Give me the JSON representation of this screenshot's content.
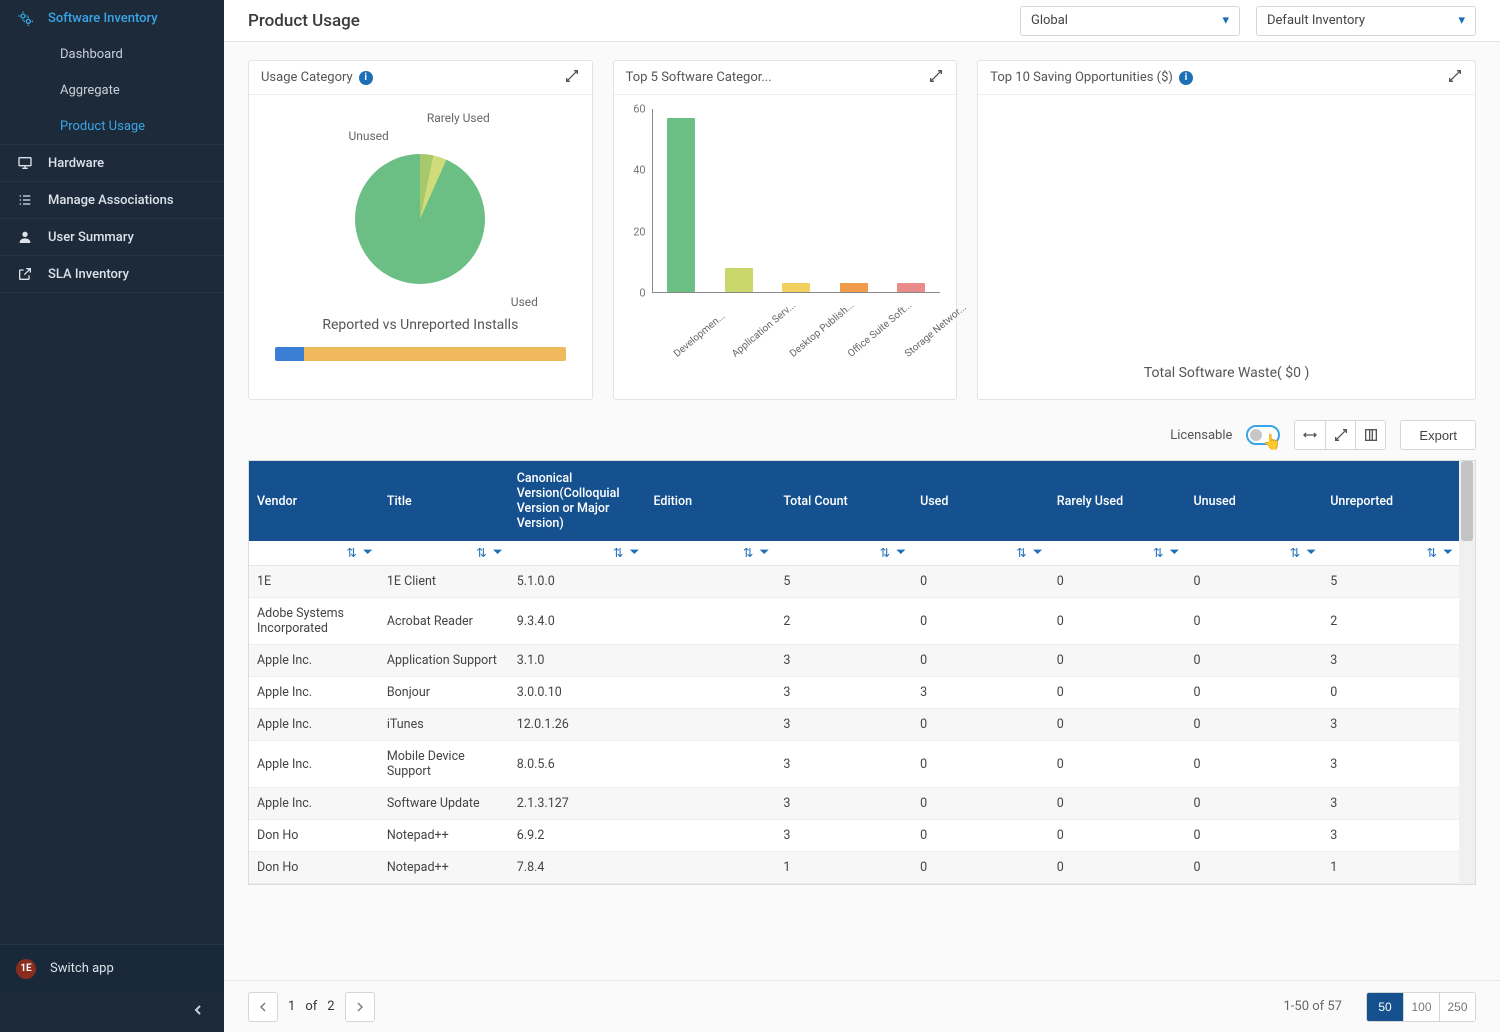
{
  "sidebar": {
    "software_inventory": "Software Inventory",
    "dashboard": "Dashboard",
    "aggregate": "Aggregate",
    "product_usage": "Product Usage",
    "hardware": "Hardware",
    "manage_assoc": "Manage Associations",
    "user_summary": "User Summary",
    "sla_inventory": "SLA Inventory",
    "switch_app": "Switch app"
  },
  "header": {
    "title": "Product Usage",
    "scope": "Global",
    "inventory": "Default Inventory"
  },
  "cards": {
    "usage_category": {
      "title": "Usage Category",
      "labels": {
        "rarely": "Rarely Used",
        "unused": "Unused",
        "used": "Used"
      },
      "subtitle": "Reported vs Unreported Installs"
    },
    "top5": {
      "title": "Top 5 Software Categor..."
    },
    "top10": {
      "title": "Top 10 Saving Opportunities ($)",
      "waste": "Total Software Waste( $0 )"
    }
  },
  "chart_data": [
    {
      "type": "pie",
      "series": [
        {
          "name": "Used",
          "value": 93
        },
        {
          "name": "Rarely Used",
          "value": 3
        },
        {
          "name": "Unused",
          "value": 4
        }
      ],
      "note": "values estimated from slice angle"
    },
    {
      "type": "bar",
      "title": "Top 5 Software Categories",
      "ylim": [
        0,
        60
      ],
      "yticks": [
        0,
        20,
        40,
        60
      ],
      "categories": [
        "Developmen...",
        "Application Serv...",
        "Desktop Publish...",
        "Office Suite Soft...",
        "Storage Networ..."
      ],
      "values": [
        57,
        8,
        3,
        3,
        3
      ],
      "colors": [
        "#6cbf84",
        "#c9d76a",
        "#f3cf5d",
        "#f09b4a",
        "#e98b8b"
      ]
    },
    {
      "type": "bar",
      "title": "Reported vs Unreported Installs",
      "series": [
        {
          "name": "Reported",
          "value": 10,
          "color": "#3b7fd4"
        },
        {
          "name": "Unreported",
          "value": 90,
          "color": "#f0b95c"
        }
      ],
      "note": "stacked horizontal, percentages estimated"
    }
  ],
  "toolbar": {
    "licensable": "Licensable",
    "export": "Export"
  },
  "table": {
    "headers": {
      "vendor": "Vendor",
      "title": "Title",
      "version": "Canonical Version(Colloquial Version or Major Version)",
      "edition": "Edition",
      "total": "Total Count",
      "used": "Used",
      "rarely": "Rarely Used",
      "unused": "Unused",
      "unreported": "Unreported"
    },
    "rows": [
      {
        "vendor": "1E",
        "title": "1E Client",
        "version": "5.1.0.0",
        "edition": "",
        "total": "5",
        "used": "0",
        "rarely": "0",
        "unused": "0",
        "unreported": "5"
      },
      {
        "vendor": "Adobe Systems Incorporated",
        "title": "Acrobat Reader",
        "version": "9.3.4.0",
        "edition": "",
        "total": "2",
        "used": "0",
        "rarely": "0",
        "unused": "0",
        "unreported": "2"
      },
      {
        "vendor": "Apple Inc.",
        "title": "Application Support",
        "version": "3.1.0",
        "edition": "",
        "total": "3",
        "used": "0",
        "rarely": "0",
        "unused": "0",
        "unreported": "3"
      },
      {
        "vendor": "Apple Inc.",
        "title": "Bonjour",
        "version": "3.0.0.10",
        "edition": "",
        "total": "3",
        "used": "3",
        "rarely": "0",
        "unused": "0",
        "unreported": "0"
      },
      {
        "vendor": "Apple Inc.",
        "title": "iTunes",
        "version": "12.0.1.26",
        "edition": "",
        "total": "3",
        "used": "0",
        "rarely": "0",
        "unused": "0",
        "unreported": "3"
      },
      {
        "vendor": "Apple Inc.",
        "title": "Mobile Device Support",
        "version": "8.0.5.6",
        "edition": "",
        "total": "3",
        "used": "0",
        "rarely": "0",
        "unused": "0",
        "unreported": "3"
      },
      {
        "vendor": "Apple Inc.",
        "title": "Software Update",
        "version": "2.1.3.127",
        "edition": "",
        "total": "3",
        "used": "0",
        "rarely": "0",
        "unused": "0",
        "unreported": "3"
      },
      {
        "vendor": "Don Ho",
        "title": "Notepad++",
        "version": "6.9.2",
        "edition": "",
        "total": "3",
        "used": "0",
        "rarely": "0",
        "unused": "0",
        "unreported": "3"
      },
      {
        "vendor": "Don Ho",
        "title": "Notepad++",
        "version": "7.8.4",
        "edition": "",
        "total": "1",
        "used": "0",
        "rarely": "0",
        "unused": "0",
        "unreported": "1"
      }
    ]
  },
  "pager": {
    "page": "1",
    "of": "of",
    "total_pages": "2",
    "range": "1-50 of 57",
    "sizes": [
      "50",
      "100",
      "250"
    ]
  }
}
